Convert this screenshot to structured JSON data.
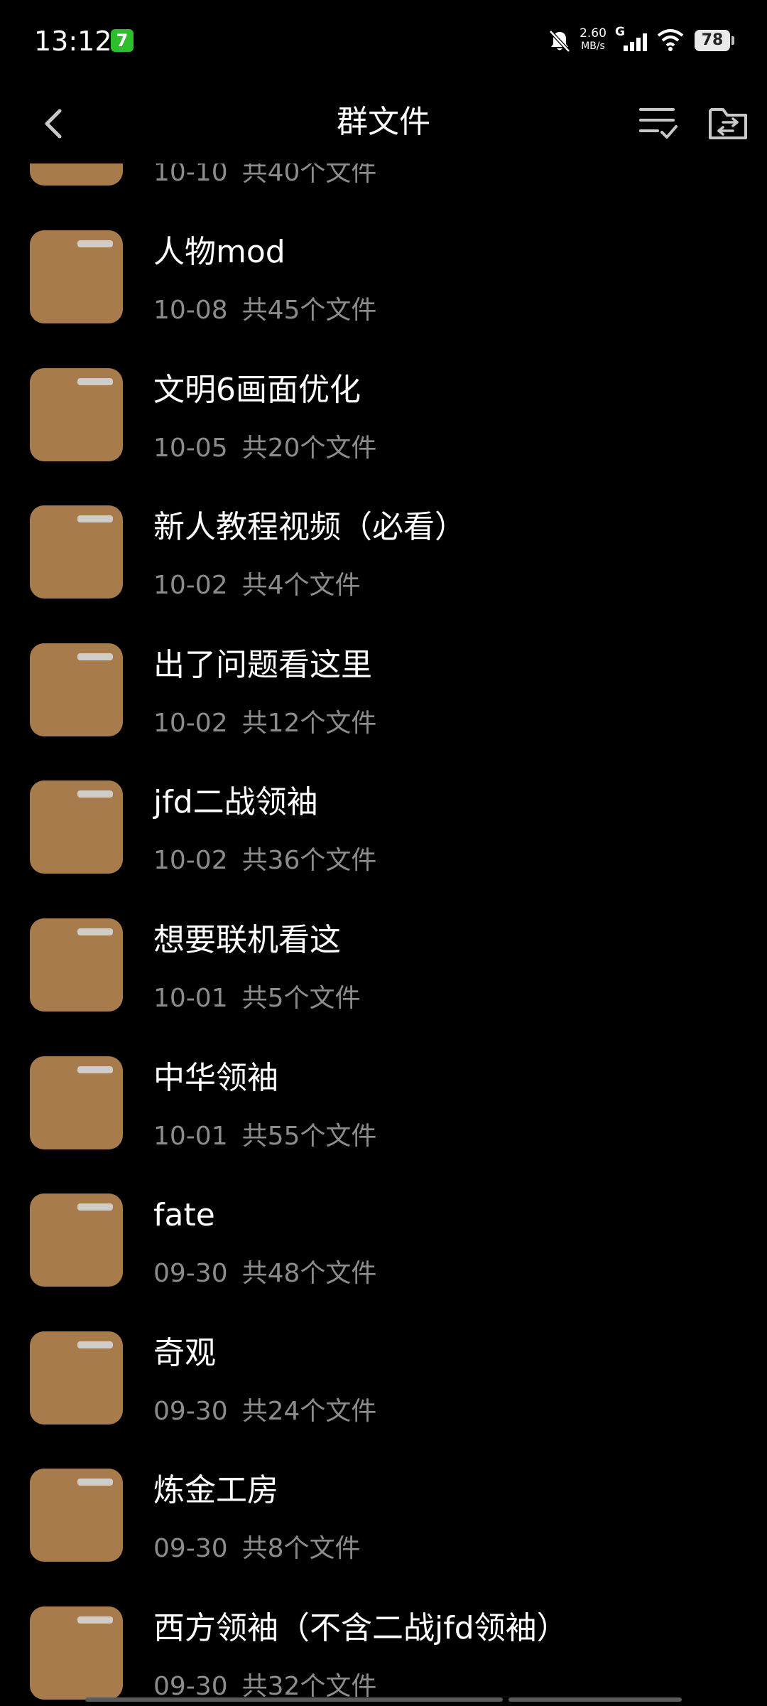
{
  "status_bar": {
    "time": "13:12",
    "app_badge_glyph": "7",
    "speed_value": "2.60",
    "speed_unit": "MB/s",
    "network_label": "G",
    "battery": "78",
    "icons": [
      "bell-muted-icon",
      "cell-signal-icon",
      "wifi-icon",
      "battery-icon"
    ]
  },
  "header": {
    "title": "群文件",
    "icons": [
      "back-chevron-icon",
      "checklist-icon",
      "folder-switch-icon"
    ]
  },
  "folders": [
    {
      "name": "",
      "date": "10-10",
      "count": "共40个文件"
    },
    {
      "name": "人物mod",
      "date": "10-08",
      "count": "共45个文件"
    },
    {
      "name": "文明6画面优化",
      "date": "10-05",
      "count": "共20个文件"
    },
    {
      "name": "新人教程视频（必看）",
      "date": "10-02",
      "count": "共4个文件"
    },
    {
      "name": "出了问题看这里",
      "date": "10-02",
      "count": "共12个文件"
    },
    {
      "name": "jfd二战领袖",
      "date": "10-02",
      "count": "共36个文件"
    },
    {
      "name": "想要联机看这",
      "date": "10-01",
      "count": "共5个文件"
    },
    {
      "name": "中华领袖",
      "date": "10-01",
      "count": "共55个文件"
    },
    {
      "name": "fate",
      "date": "09-30",
      "count": "共48个文件"
    },
    {
      "name": "奇观",
      "date": "09-30",
      "count": "共24个文件"
    },
    {
      "name": "炼金工房",
      "date": "09-30",
      "count": "共8个文件"
    },
    {
      "name": "西方领袖（不含二战jfd领袖）",
      "date": "09-30",
      "count": "共32个文件"
    }
  ],
  "colors": {
    "background": "#000000",
    "folder": "#a87b4c",
    "meta_text": "#8c8c8c"
  }
}
